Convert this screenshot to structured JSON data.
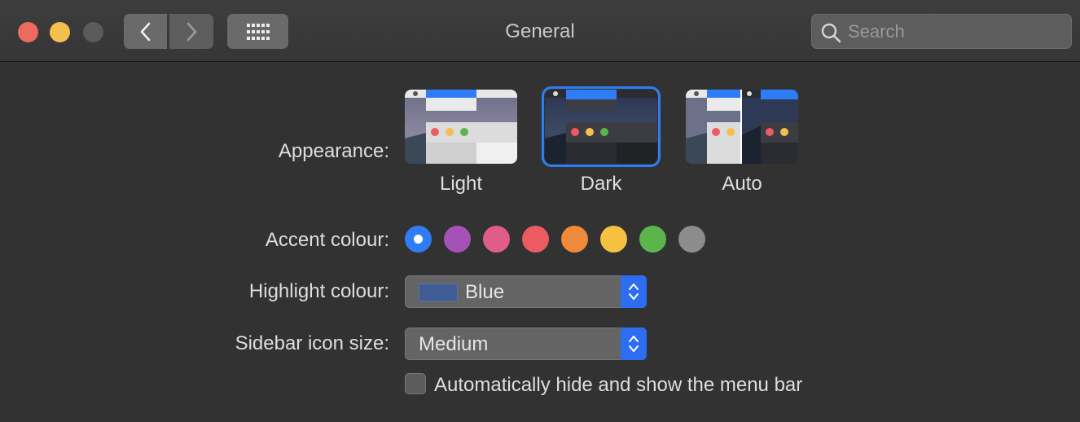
{
  "window": {
    "title": "General"
  },
  "search": {
    "placeholder": "Search"
  },
  "appearance": {
    "label": "Appearance:",
    "options": [
      {
        "name": "Light",
        "selected": false
      },
      {
        "name": "Dark",
        "selected": true
      },
      {
        "name": "Auto",
        "selected": false
      }
    ]
  },
  "accent": {
    "label": "Accent colour:",
    "colors": [
      "#2f7df6",
      "#a651b7",
      "#e05d8b",
      "#ec5b62",
      "#ee8a3a",
      "#f6c041",
      "#5bb54b",
      "#8c8c8c"
    ],
    "selected_index": 0
  },
  "highlight": {
    "label": "Highlight colour:",
    "value": "Blue",
    "swatch_color": "#3f5d94"
  },
  "sidebar": {
    "label": "Sidebar icon size:",
    "value": "Medium"
  },
  "menubar": {
    "label": "Automatically hide and show the menu bar",
    "checked": false
  },
  "icons": {
    "back": "chevron-left-icon",
    "forward": "chevron-right-icon",
    "grid": "grid-icon",
    "search": "magnifier-icon"
  }
}
